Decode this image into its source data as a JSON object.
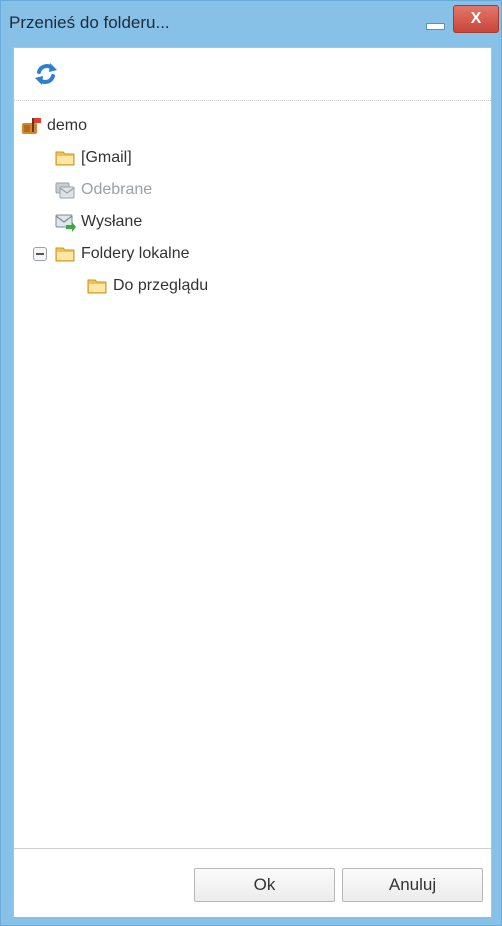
{
  "window": {
    "title": "Przenieś do folderu...",
    "close_glyph": "X",
    "colors": {
      "titlebar": "#87c1e8",
      "close": "#c9453a",
      "folder": "#f6c14b"
    }
  },
  "toolbar": {
    "refresh_icon": "refresh-icon"
  },
  "tree": {
    "items": [
      {
        "label": "demo",
        "icon": "mailbox-icon"
      },
      {
        "label": "[Gmail]",
        "icon": "folder-icon"
      },
      {
        "label": "Odebrane",
        "icon": "inbox-icon",
        "disabled": true
      },
      {
        "label": "Wysłane",
        "icon": "sent-icon"
      },
      {
        "label": "Foldery lokalne",
        "icon": "folder-icon",
        "expanded": true
      },
      {
        "label": "Do przeglądu",
        "icon": "folder-icon"
      }
    ]
  },
  "footer": {
    "ok_label": "Ok",
    "cancel_label": "Anuluj"
  }
}
